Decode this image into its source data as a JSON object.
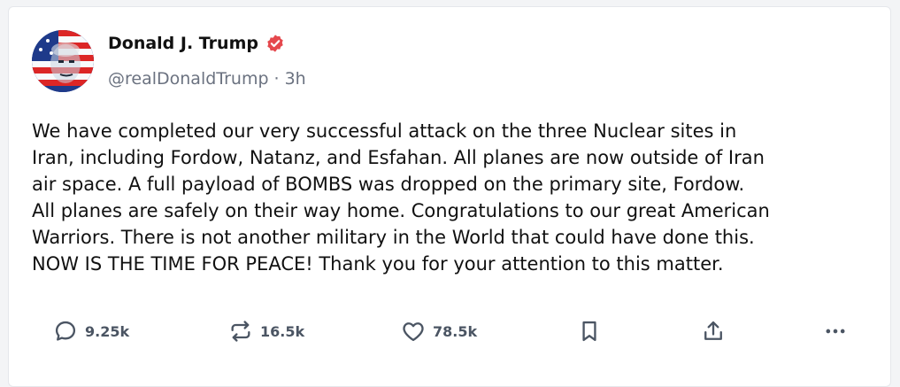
{
  "post": {
    "author_name": "Donald J. Trump",
    "handle": "@realDonaldTrump",
    "separator": "·",
    "time": "3h",
    "text_lines": [
      "We have completed our very successful attack on the three Nuclear sites in",
      "Iran, including Fordow, Natanz, and Esfahan. All planes are now outside of Iran",
      "air space. A full payload of BOMBS was dropped on the primary site, Fordow.",
      "All planes are safely on their way home. Congratulations to our great American",
      "Warriors. There is not another military in the World that could have done this.",
      "NOW IS THE TIME FOR PEACE! Thank you for your attention to this matter."
    ]
  },
  "actions": {
    "replies": "9.25k",
    "reposts": "16.5k",
    "likes": "78.5k"
  },
  "icons": {
    "reply": "speech-bubble-icon",
    "repost": "repost-arrows-icon",
    "like": "heart-icon",
    "bookmark": "bookmark-icon",
    "share": "share-upload-icon",
    "more": "more-dots-icon",
    "verified": "verified-badge-icon"
  },
  "colors": {
    "verified_badge": "#e5484d",
    "text_primary": "#111111",
    "text_secondary": "#6b7280",
    "icon": "#4b5563"
  }
}
